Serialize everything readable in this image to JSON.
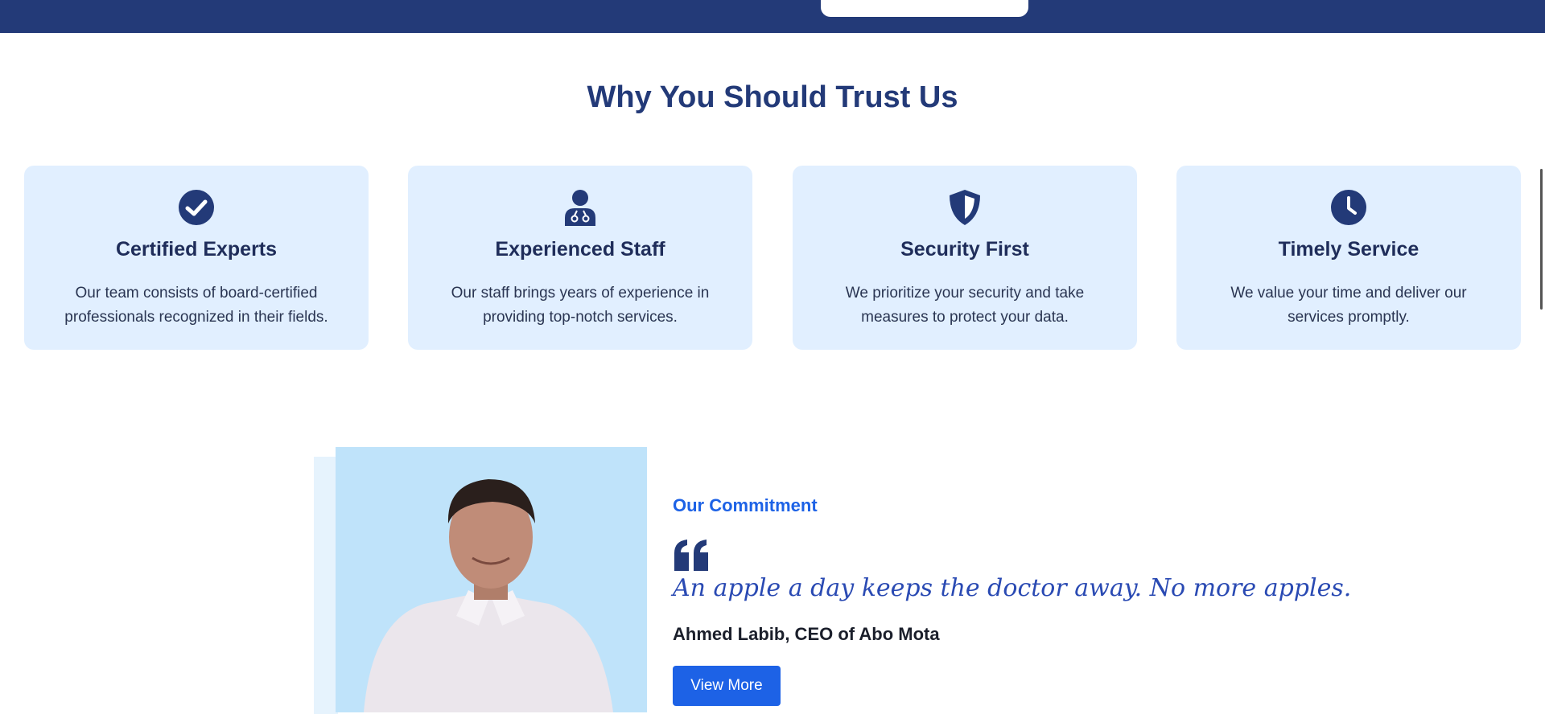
{
  "section": {
    "title": "Why You Should Trust Us"
  },
  "cards": [
    {
      "icon": "check-circle-icon",
      "title": "Certified Experts",
      "desc": "Our team consists of board-certified professionals recognized in their fields."
    },
    {
      "icon": "doctor-icon",
      "title": "Experienced Staff",
      "desc": "Our staff brings years of experience in providing top-notch services."
    },
    {
      "icon": "shield-icon",
      "title": "Security First",
      "desc": "We prioritize your security and take measures to protect your data."
    },
    {
      "icon": "clock-icon",
      "title": "Timely Service",
      "desc": "We value your time and deliver our services promptly."
    }
  ],
  "commitment": {
    "kicker": "Our Commitment",
    "quote_icon": "quote-left-icon",
    "quote": "An apple a day keeps the doctor away. No more apples.",
    "author": "Ahmed Labib, CEO of Abo Mota",
    "button": "View More"
  },
  "colors": {
    "navy": "#233a78",
    "accent": "#1d62e6",
    "card_bg": "#e1efff"
  }
}
